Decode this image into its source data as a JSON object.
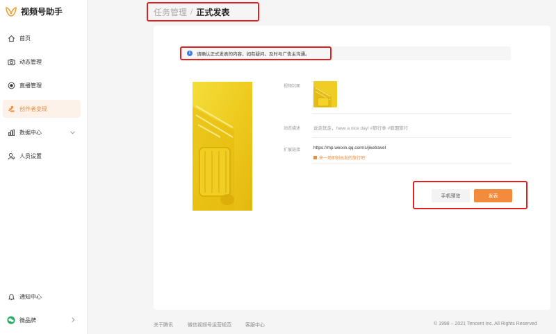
{
  "app": {
    "title": "视频号助手"
  },
  "sidebar": {
    "items": [
      {
        "label": "首页",
        "icon": "home-icon"
      },
      {
        "label": "动态管理",
        "icon": "camera-icon"
      },
      {
        "label": "直播管理",
        "icon": "live-icon"
      },
      {
        "label": "创作者变现",
        "icon": "monetize-icon",
        "active": true
      },
      {
        "label": "数据中心",
        "icon": "chart-icon",
        "expandable": true
      },
      {
        "label": "人员设置",
        "icon": "user-settings-icon"
      }
    ],
    "bottom": [
      {
        "label": "通知中心",
        "icon": "bell-icon"
      },
      {
        "label": "微品牌",
        "icon": "brand-icon",
        "expandable": true
      }
    ]
  },
  "breadcrumb": {
    "parent": "任务管理",
    "separator": "/",
    "current": "正式发表"
  },
  "notice": {
    "text": "请确认正式发表的内容，如有疑问，及时与广告主沟通。"
  },
  "form": {
    "cover_label": "视频封面",
    "desc_label": "动态描述",
    "desc_value": "说走就走，have a nice day! #旅行季 #假期旅行",
    "link_label": "扩展链接",
    "link_url": "https://mp.weixin.qq.com/s/jiketravel",
    "link_title": "来一场即刻出发的旅行吧"
  },
  "actions": {
    "preview_label": "手机预览",
    "publish_label": "发表"
  },
  "footer": {
    "links": [
      "关于腾讯",
      "微信视频号运营规范",
      "客服中心"
    ],
    "copyright": "© 1998 – 2021 Tencent Inc. All Rights Reserved"
  },
  "colors": {
    "accent": "#f28b3c",
    "highlight": "#e02020",
    "cover_yellow": "#f2d42a"
  }
}
